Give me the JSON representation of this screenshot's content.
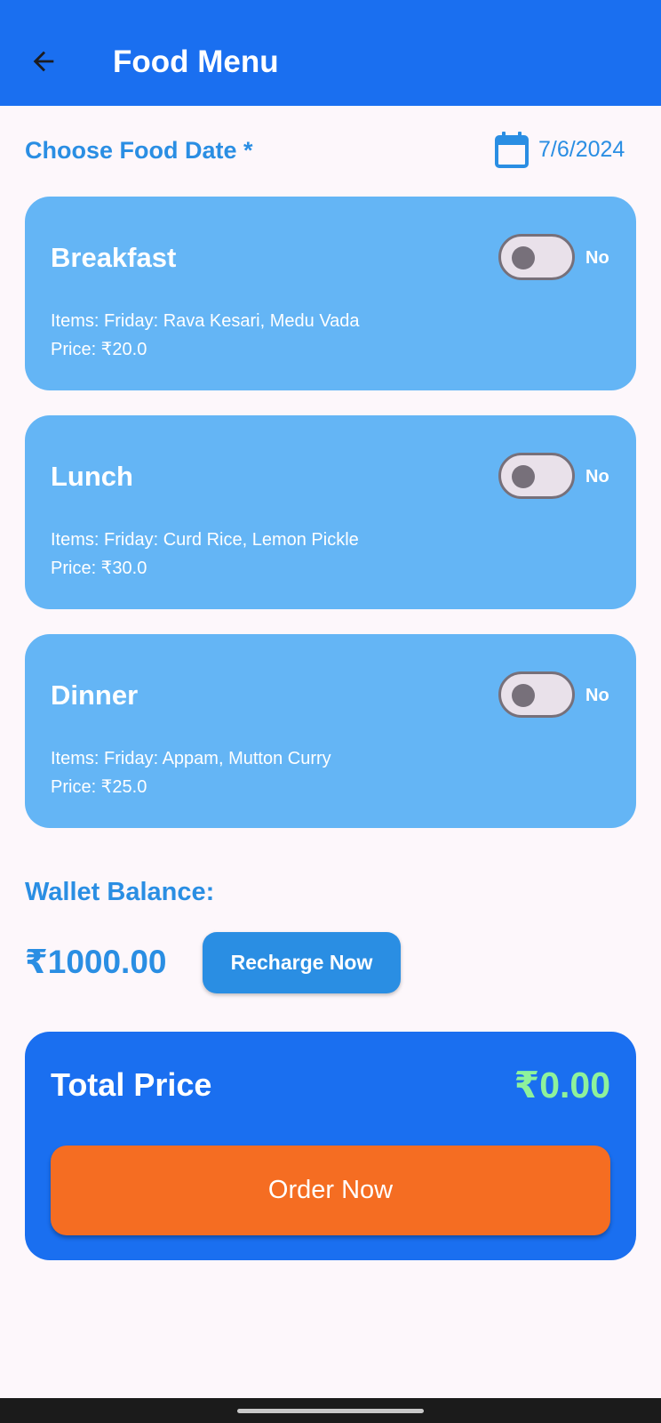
{
  "app_bar": {
    "title": "Food Menu",
    "back_icon": "arrow-back-icon",
    "background": "#1a6ff0"
  },
  "date_section": {
    "label": "Choose Food Date *",
    "date_value": "7/6/2024",
    "icon": "calendar-icon",
    "color": "#2a8ee3"
  },
  "meals": [
    {
      "name": "Breakfast",
      "items": "Items: Friday: Rava Kesari, Medu Vada",
      "price": "Price: ₹20.0",
      "toggle_on": false,
      "toggle_label": "No"
    },
    {
      "name": "Lunch",
      "items": "Items: Friday: Curd Rice, Lemon Pickle",
      "price": "Price: ₹30.0",
      "toggle_on": false,
      "toggle_label": "No"
    },
    {
      "name": "Dinner",
      "items": "Items: Friday: Appam, Mutton Curry",
      "price": "Price: ₹25.0",
      "toggle_on": false,
      "toggle_label": "No"
    }
  ],
  "wallet": {
    "label": "Wallet Balance:",
    "balance": "₹1000.00",
    "recharge_label": "Recharge Now"
  },
  "total": {
    "label": "Total Price",
    "value": "₹0.00",
    "value_color": "#8ef29b",
    "order_label": "Order Now",
    "order_color": "#f56d22"
  },
  "colors": {
    "card": "#64b5f5",
    "primary": "#1a6ff0",
    "accent_text": "#2a8ee3",
    "page_background": "#fdf7fb"
  }
}
